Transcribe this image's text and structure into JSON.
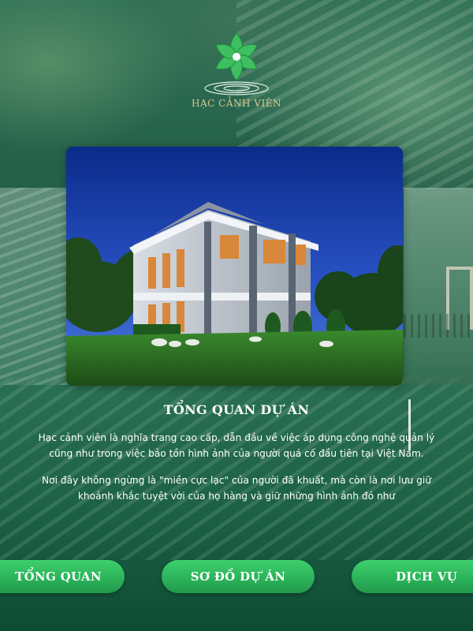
{
  "logo": {
    "text": "HẠC CẢNH VIÊN",
    "icon": "lotus-flower-logo-icon",
    "colors": {
      "petal": "#3fbf5f",
      "petal_dark": "#1f8a45",
      "text": "#d9c98a"
    }
  },
  "hero": {
    "image": "villa-at-night-photo"
  },
  "content": {
    "title": "TỔNG QUAN DỰ ÁN",
    "paragraphs": [
      "Hạc cảnh viên là nghĩa trang cao cấp, dẫn đầu về việc áp dụng công nghệ quản lý cũng như trong việc bảo tồn hình ảnh của người quá cố đầu tiên tại Việt Nam.",
      "Nơi đây không ngừng là \"miền cực lạc\" của người đã khuất, mà còn là nơi lưu giữ khoảnh khắc tuyệt vời của họ hàng và giữ những hình ảnh đó như"
    ]
  },
  "nav": {
    "items": [
      {
        "label": "TỔNG QUAN"
      },
      {
        "label": "SƠ ĐỒ DỰ ÁN"
      },
      {
        "label": "DỊCH VỤ"
      }
    ],
    "color": "#2bb35a"
  }
}
